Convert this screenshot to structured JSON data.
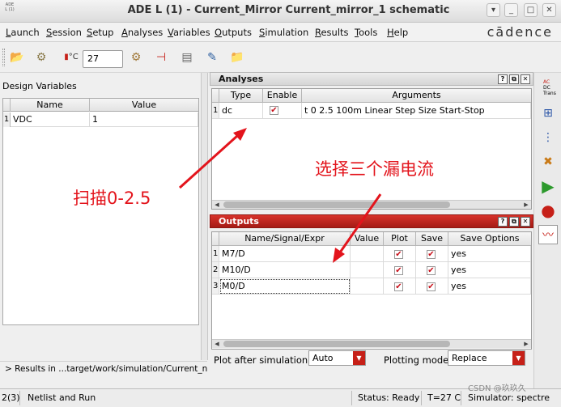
{
  "window": {
    "title": "ADE L (1) - Current_Mirror Current_mirror_1 schematic",
    "icon_text": "ADE L (1)"
  },
  "menu": [
    "Launch",
    "Session",
    "Setup",
    "Analyses",
    "Variables",
    "Outputs",
    "Simulation",
    "Results",
    "Tools",
    "Help"
  ],
  "brand": "cādence",
  "toolbar": {
    "temperature": "27",
    "temp_unit": "°C"
  },
  "design_variables": {
    "header": "Design Variables",
    "columns": [
      "Name",
      "Value"
    ],
    "rows": [
      {
        "num": "1",
        "name": "VDC",
        "value": "1"
      }
    ]
  },
  "results_path": "> Results in ...target/work/simulation/Current_n",
  "analyses": {
    "title": "Analyses",
    "columns": [
      "Type",
      "Enable",
      "Arguments"
    ],
    "rows": [
      {
        "num": "1",
        "type": "dc",
        "enabled": true,
        "arguments": "t 0 2.5 100m Linear Step Size Start-Stop"
      }
    ]
  },
  "outputs": {
    "title": "Outputs",
    "columns": [
      "Name/Signal/Expr",
      "Value",
      "Plot",
      "Save",
      "Save Options"
    ],
    "rows": [
      {
        "num": "1",
        "name": "M7/D",
        "value": "",
        "plot": true,
        "save": true,
        "save_options": "yes"
      },
      {
        "num": "2",
        "name": "M10/D",
        "value": "",
        "plot": true,
        "save": true,
        "save_options": "yes"
      },
      {
        "num": "3",
        "name": "M0/D",
        "value": "",
        "plot": true,
        "save": true,
        "save_options": "yes"
      }
    ]
  },
  "plot_after": {
    "label": "Plot after simulation:",
    "value": "Auto"
  },
  "plotting_mode": {
    "label": "Plotting mode:",
    "value": "Replace"
  },
  "side_toolbar": {
    "ac_dc_trans": [
      "AC",
      "DC",
      "Trans"
    ]
  },
  "status": {
    "count": "2(3)",
    "task": "Netlist and Run",
    "state": "Status: Ready",
    "temp": "T=27 C",
    "simulator": "Simulator: spectre"
  },
  "annotations": {
    "sweep": "扫描0-2.5",
    "select_drain": "选择三个漏电流"
  },
  "watermark": "CSDN @玖玖久",
  "colors": {
    "accent_red": "#c62018",
    "annotation_red": "#e3141c"
  }
}
